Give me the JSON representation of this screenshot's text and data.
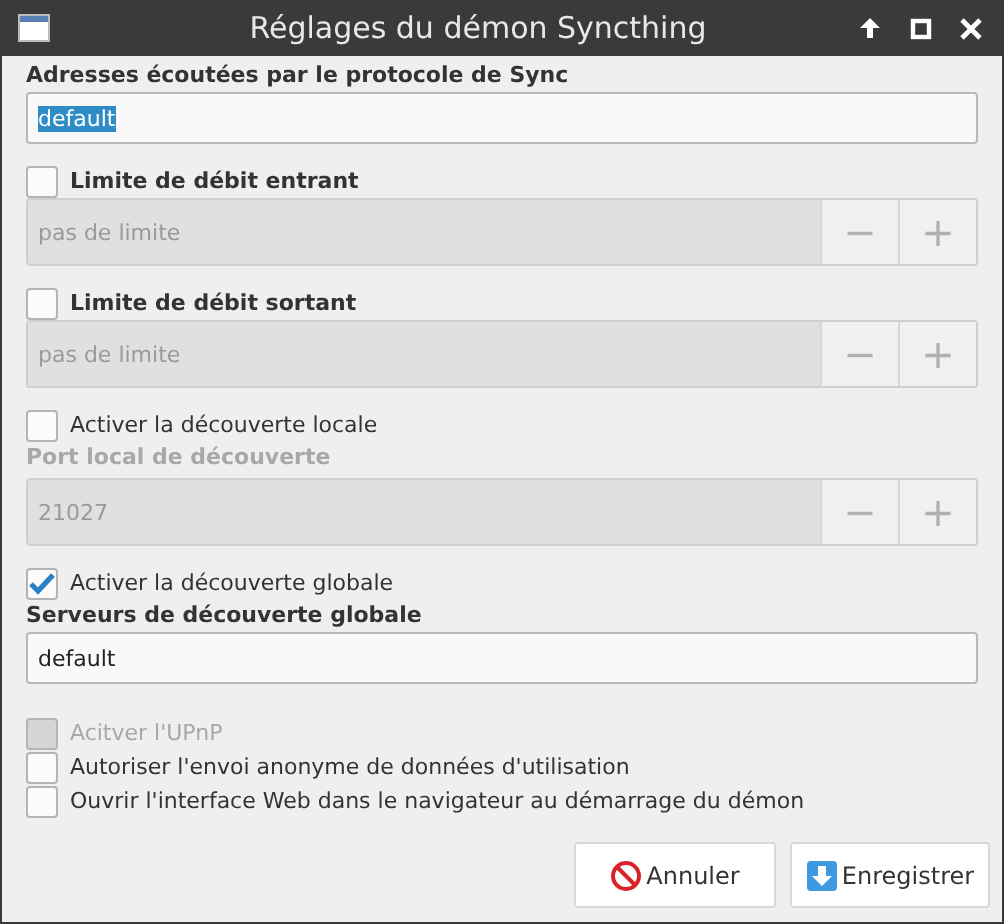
{
  "window": {
    "title": "Réglages du démon Syncthing"
  },
  "items": [
    {
      "kind": "label",
      "text": "Adresses écoutées par le protocole de Sync",
      "disabled": false
    },
    {
      "kind": "field",
      "value": "default",
      "text_selected": true
    },
    {
      "kind": "checkbox",
      "label": "Limite de débit entrant",
      "checked": false,
      "disabled": false,
      "bold": true
    },
    {
      "kind": "spin",
      "value": "pas de limite",
      "disabled": true,
      "minus": "−",
      "plus": "+"
    },
    {
      "kind": "checkbox",
      "label": "Limite de débit sortant",
      "checked": false,
      "disabled": false,
      "bold": true
    },
    {
      "kind": "spin",
      "value": "pas de limite",
      "disabled": true,
      "minus": "−",
      "plus": "+"
    },
    {
      "kind": "checkbox",
      "label": "Activer la découverte locale",
      "checked": false,
      "disabled": false,
      "bold": false
    },
    {
      "kind": "label",
      "text": "Port local de découverte",
      "disabled": true
    },
    {
      "kind": "spin",
      "value": "21027",
      "disabled": true,
      "minus": "−",
      "plus": "+"
    },
    {
      "kind": "checkbox",
      "label": "Activer la découverte globale",
      "checked": true,
      "disabled": false,
      "bold": false
    },
    {
      "kind": "label",
      "text": "Serveurs de découverte globale",
      "disabled": false
    },
    {
      "kind": "field",
      "value": "default",
      "text_selected": false
    },
    {
      "kind": "checkbox",
      "label": "Acitver l'UPnP",
      "checked": false,
      "disabled": true,
      "bold": false
    },
    {
      "kind": "checkbox",
      "label": "Autoriser l'envoi anonyme de données d'utilisation",
      "checked": false,
      "disabled": false,
      "bold": false
    },
    {
      "kind": "checkbox",
      "label": "Ouvrir l'interface Web dans le navigateur au démarrage du démon",
      "checked": false,
      "disabled": false,
      "bold": false
    }
  ],
  "buttons": [
    {
      "label": "Annuler",
      "kind": "cancel"
    },
    {
      "label": "Enregistrer",
      "kind": "save"
    }
  ]
}
